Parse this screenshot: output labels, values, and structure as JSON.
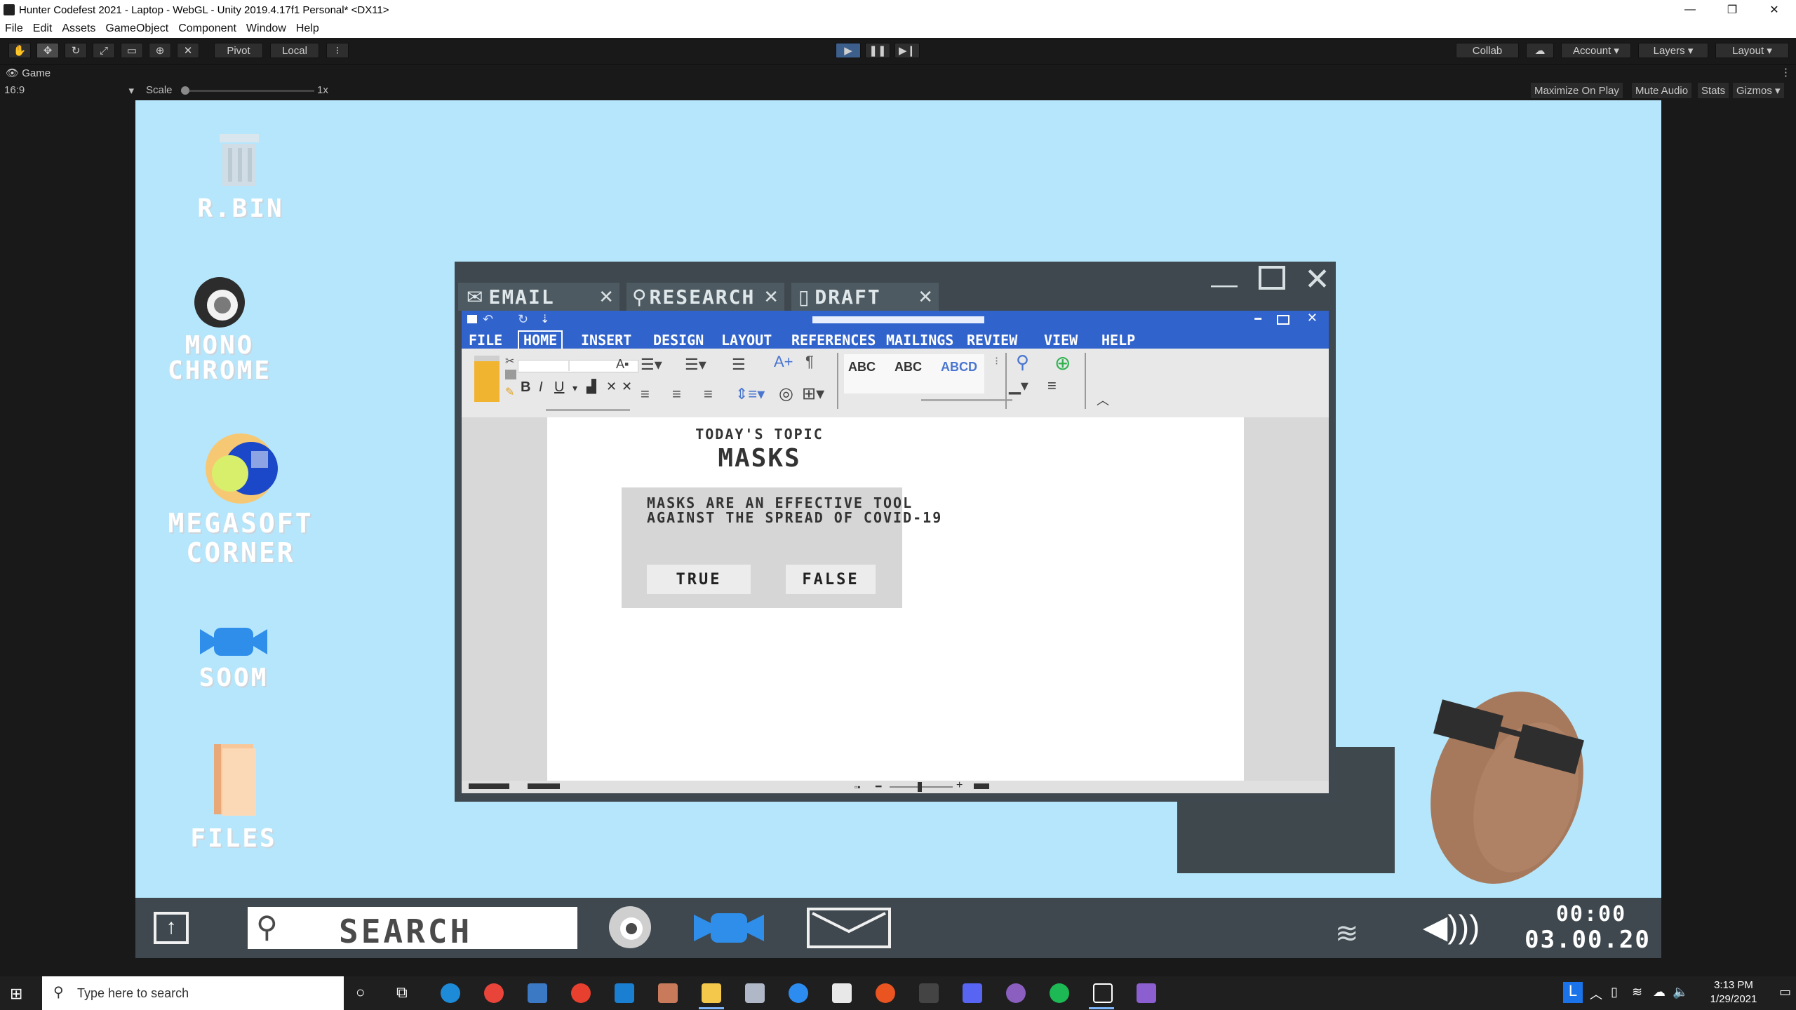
{
  "window": {
    "title": "Hunter Codefest 2021 - Laptop - WebGL - Unity 2019.4.17f1 Personal* <DX11>",
    "controls": [
      "—",
      "❐",
      "✕"
    ]
  },
  "menu": [
    "File",
    "Edit",
    "Assets",
    "GameObject",
    "Component",
    "Window",
    "Help"
  ],
  "toolbar": {
    "pivot_label": "Pivot",
    "local_label": "Local",
    "collab_label": "Collab",
    "account_label": "Account",
    "layers_label": "Layers",
    "layout_label": "Layout"
  },
  "game_panel": {
    "tab_label": "Game",
    "aspect": "16:9",
    "scale_label": "Scale",
    "scale_value": "1x",
    "maximize_label": "Maximize On Play",
    "mute_label": "Mute Audio",
    "stats_label": "Stats",
    "gizmos_label": "Gizmos"
  },
  "desktop_icons": [
    {
      "label": "R.BIN"
    },
    {
      "label": "MONO\nCHROME"
    },
    {
      "label": "MEGASOFT\nCORNER"
    },
    {
      "label": "SOOM"
    },
    {
      "label": "FILES"
    }
  ],
  "game_window": {
    "tabs": [
      "EMAIL",
      "RESEARCH",
      "DRAFT"
    ],
    "ribbon_tabs": [
      "FILE",
      "HOME",
      "INSERT",
      "DESIGN",
      "LAYOUT",
      "REFERENCES",
      "MAILINGS",
      "REVIEW",
      "VIEW",
      "HELP"
    ],
    "doc_heading": "TODAY'S TOPIC",
    "doc_title": "MASKS",
    "question": "MASKS ARE AN EFFECTIVE TOOL\nAGAINST THE SPREAD OF COVID-19",
    "true_label": "TRUE",
    "false_label": "FALSE"
  },
  "game_taskbar": {
    "search_label": "SEARCH",
    "clock_time": "00:00",
    "clock_date": "03.00.20"
  },
  "win_taskbar": {
    "search_placeholder": "Type here to search",
    "time": "3:13 PM",
    "date": "1/29/2021"
  }
}
